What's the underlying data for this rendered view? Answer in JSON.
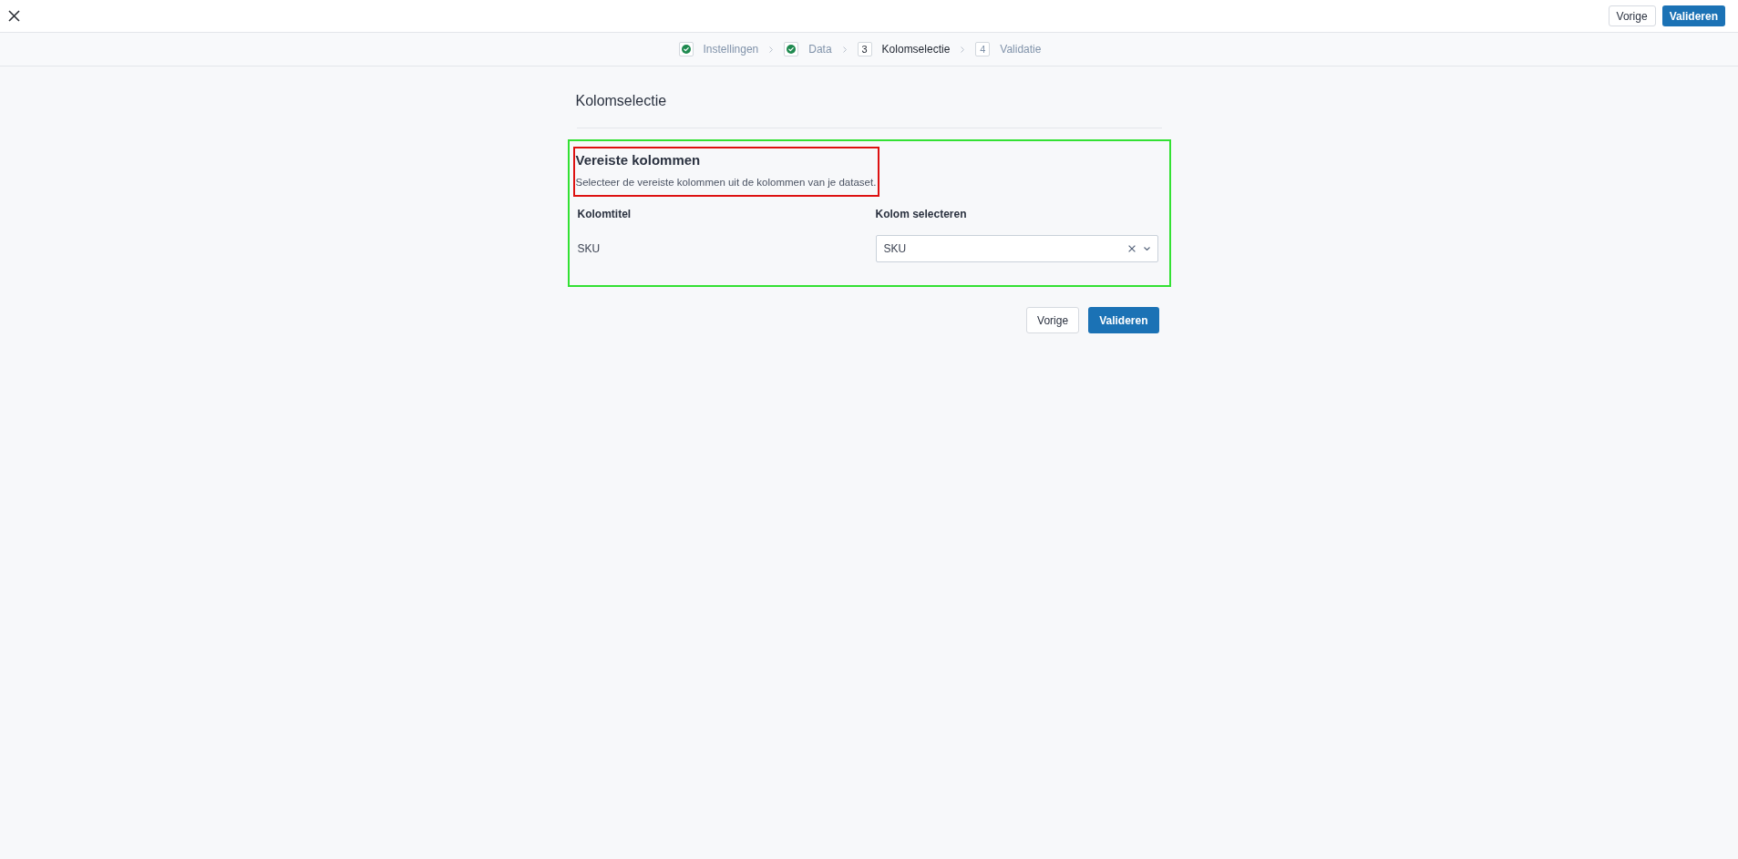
{
  "top_bar": {
    "buttons": [
      {
        "label": "Vorige",
        "kind": "secondary"
      },
      {
        "label": "Valideren",
        "kind": "primary"
      }
    ]
  },
  "stepper": {
    "steps": [
      {
        "label": "Instellingen",
        "done": true,
        "selected": false
      },
      {
        "label": "Data",
        "done": true,
        "selected": false
      },
      {
        "number": "3",
        "label": "Kolomselectie",
        "done": false,
        "selected": true
      },
      {
        "number": "4",
        "label": "Validatie",
        "done": false,
        "selected": false
      }
    ]
  },
  "page": {
    "title": "Kolomselectie"
  },
  "section": {
    "outline": {
      "color": "#33e133"
    },
    "header_outline": {
      "color": "#dd1111"
    },
    "title": "Vereiste kolommen",
    "description": "Selecteer de vereiste kolommen uit de kolommen van je dataset.",
    "columns": [
      "Kolomtitel",
      "Kolom selecteren"
    ],
    "rows": [
      {
        "title": "SKU",
        "selection": "SKU"
      }
    ]
  },
  "footer": {
    "buttons": [
      {
        "label": "Vorige",
        "kind": "secondary"
      },
      {
        "label": "Valideren",
        "kind": "primary"
      }
    ]
  }
}
